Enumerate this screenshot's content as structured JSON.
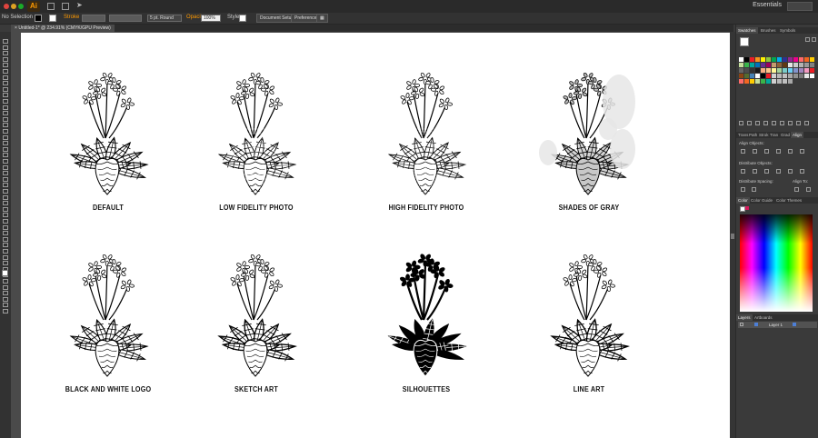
{
  "menubar": {
    "app_icon": "Ai",
    "workspace": "Essentials",
    "window_dots": [
      "#e0443e",
      "#dea123",
      "#1aab29"
    ]
  },
  "control_bar": {
    "selection": "No Selection",
    "stroke_label": "Stroke",
    "brush": "5 pt. Round",
    "opacity_label": "Opacity",
    "opacity_value": "100%",
    "style_label": "Style",
    "document_setup": "Document Setup",
    "preferences": "Preferences"
  },
  "document_tab": {
    "title": "Untitled-1* @ 234.91% (CMYK/GPU Preview)",
    "close": "×"
  },
  "artboard": {
    "items": [
      {
        "caption": "DEFAULT",
        "style": "default"
      },
      {
        "caption": "LOW FIDELITY PHOTO",
        "style": "low"
      },
      {
        "caption": "HIGH FIDELITY PHOTO",
        "style": "high"
      },
      {
        "caption": "SHADES OF GRAY",
        "style": "gray"
      },
      {
        "caption": "BLACK AND WHITE LOGO",
        "style": "bw"
      },
      {
        "caption": "SKETCH ART",
        "style": "sketch"
      },
      {
        "caption": "SILHOUETTES",
        "style": "silhouette"
      },
      {
        "caption": "LINE ART",
        "style": "line"
      }
    ]
  },
  "panels": {
    "swatches_tabs": [
      "Swatches",
      "Brushes",
      "Symbols"
    ],
    "align_tabs": [
      "Trans",
      "Path",
      "Strok",
      "Tran",
      "Grad",
      "Align"
    ],
    "align_objects": "Align Objects:",
    "distribute_objects": "Distribute Objects:",
    "distribute_spacing": "Distribute Spacing:",
    "align_to": "Align To:",
    "color_tabs": [
      "Color",
      "Color Guide",
      "Color Themes"
    ],
    "layers_tabs": [
      "Layers",
      "Artboards"
    ],
    "layer_name": "Layer 1"
  },
  "colors": {
    "accent_orange": "#ff9a00",
    "layer_blue": "#4d7fd6"
  }
}
